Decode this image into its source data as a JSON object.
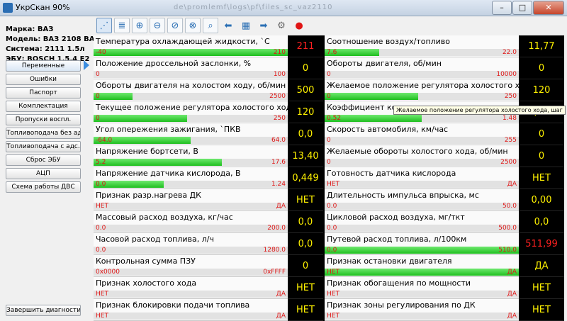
{
  "window": {
    "title": "УкрСкан 90%",
    "blurred_caption": "de\\promlemf\\logs\\pf\\files_sc_vaz2110",
    "buttons": [
      "–",
      "□",
      "✕"
    ]
  },
  "info": [
    "Марка: ВАЗ",
    "Модель: ВАЗ 2108 ВАЗ 210",
    "Система: 2111 1.5л",
    "ЭБУ: BOSCH 1.5.4 E2"
  ],
  "sidebar": [
    "Переменные",
    "Ошибки",
    "Паспорт",
    "Комплектация",
    "Пропуски воспл.",
    "Топливоподача без адс.",
    "Топливоподача с адс.",
    "Сброс ЭБУ",
    "АЦП",
    "Схема работы ДВС"
  ],
  "finish_button": "Завершить диагностику",
  "toolbar": [
    {
      "name": "chart-icon",
      "glyph": "⋰"
    },
    {
      "name": "list-icon",
      "glyph": "≣"
    },
    {
      "name": "zoom-in-icon",
      "glyph": "⊕"
    },
    {
      "name": "zoom-out-icon",
      "glyph": "⊖"
    },
    {
      "name": "zoom-fit-icon",
      "glyph": "⊘"
    },
    {
      "name": "zoom-reset-icon",
      "glyph": "⊗"
    },
    {
      "name": "search-icon",
      "glyph": "⌕"
    },
    {
      "name": "arrow-left-icon",
      "glyph": "⬅"
    },
    {
      "name": "table-icon",
      "glyph": "▦"
    },
    {
      "name": "arrow-right-icon",
      "glyph": "➡"
    },
    {
      "name": "gear-icon",
      "glyph": "⚙"
    },
    {
      "name": "record-icon",
      "glyph": "●"
    }
  ],
  "colors": {
    "value_text": "#fff200",
    "value_alert": "#ff2020",
    "bar_fill": "#1fbf1f",
    "range_text": "#e01515"
  },
  "tooltip": "Желаемое положение регулятора холостого хода, шаг",
  "parameters_left": [
    {
      "label": "Температура охлаждающей жидкости, `C",
      "min": "-40",
      "max": "210",
      "value": "211",
      "fill": 1.0,
      "alert": true
    },
    {
      "label": "Положение дроссельной заслонки, %",
      "min": "0",
      "max": "100",
      "value": "0",
      "fill": 0
    },
    {
      "label": "Обороты двигателя на холостом ходу, об/мин",
      "min": "0",
      "max": "2500",
      "value": "500",
      "fill": 0.2
    },
    {
      "label": "Текущее положение регулятора холостого хода, шаг",
      "min": "0",
      "max": "250",
      "value": "120",
      "fill": 0.48
    },
    {
      "label": "Угол опережения зажигания, `ПКВ",
      "min": "-64.0",
      "max": "64.0",
      "value": "0,0",
      "fill": 0.5
    },
    {
      "label": "Напряжение бортсети, В",
      "min": "5.2",
      "max": "17.6",
      "value": "13,40",
      "fill": 0.66
    },
    {
      "label": "Напряжение датчика кислорода, В",
      "min": "0.0",
      "max": "1.24",
      "value": "0,449",
      "fill": 0.36
    },
    {
      "label": "Признак разр.нагрева ДК",
      "min": "НЕТ",
      "max": "ДА",
      "value": "НЕТ",
      "fill": 0
    },
    {
      "label": "Массовый расход воздуха, кг/час",
      "min": "0.0",
      "max": "200.0",
      "value": "0,0",
      "fill": 0
    },
    {
      "label": "Часовой расход топлива, л/ч",
      "min": "0.0",
      "max": "1280.0",
      "value": "0,0",
      "fill": 0
    },
    {
      "label": "Контрольная сумма ПЗУ",
      "min": "0x0000",
      "max": "0xFFFF",
      "value": "0",
      "fill": 0
    },
    {
      "label": "Признак холостого хода",
      "min": "НЕТ",
      "max": "ДА",
      "value": "НЕТ",
      "fill": 0
    },
    {
      "label": "Признак блокировки подачи топлива",
      "min": "НЕТ",
      "max": "ДА",
      "value": "НЕТ",
      "fill": 0
    }
  ],
  "parameters_right": [
    {
      "label": "Соотношение воздух/топливо",
      "min": "7.6",
      "max": "22.0",
      "value": "11,77",
      "fill": 0.28
    },
    {
      "label": "Обороты двигателя, об/мин",
      "min": "0",
      "max": "10000",
      "value": "0",
      "fill": 0
    },
    {
      "label": "Желаемое положение регулятора холостого хода, шаг",
      "min": "0",
      "max": "250",
      "value": "120",
      "fill": 0.48
    },
    {
      "label": "Коэффициент коррекции времени впрыска",
      "min": "0.52",
      "max": "1.48",
      "value": "1,000",
      "fill": 0.5
    },
    {
      "label": "Скорость автомобиля, км/час",
      "min": "0",
      "max": "255",
      "value": "0",
      "fill": 0
    },
    {
      "label": "Желаемые обороты холостого хода, об/мин",
      "min": "0",
      "max": "2500",
      "value": "0",
      "fill": 0
    },
    {
      "label": "Готовность датчика кислорода",
      "min": "НЕТ",
      "max": "ДА",
      "value": "НЕТ",
      "fill": 0
    },
    {
      "label": "Длительность импульса впрыска, мс",
      "min": "0.0",
      "max": "50.0",
      "value": "0,00",
      "fill": 0
    },
    {
      "label": "Цикловой расход воздуха, мг/ткт",
      "min": "0.0",
      "max": "500.0",
      "value": "0,0",
      "fill": 0
    },
    {
      "label": "Путевой расход топлива, л/100км",
      "min": "0.0",
      "max": "510.0",
      "value": "511,99",
      "fill": 1.0,
      "alert": true
    },
    {
      "label": "Признак остановки двигателя",
      "min": "НЕТ",
      "max": "ДА",
      "value": "ДА",
      "fill": 1.0
    },
    {
      "label": "Признак обогащения по мощности",
      "min": "НЕТ",
      "max": "ДА",
      "value": "НЕТ",
      "fill": 0
    },
    {
      "label": "Признак зоны регулирования по ДК",
      "min": "НЕТ",
      "max": "ДА",
      "value": "НЕТ",
      "fill": 0
    }
  ]
}
